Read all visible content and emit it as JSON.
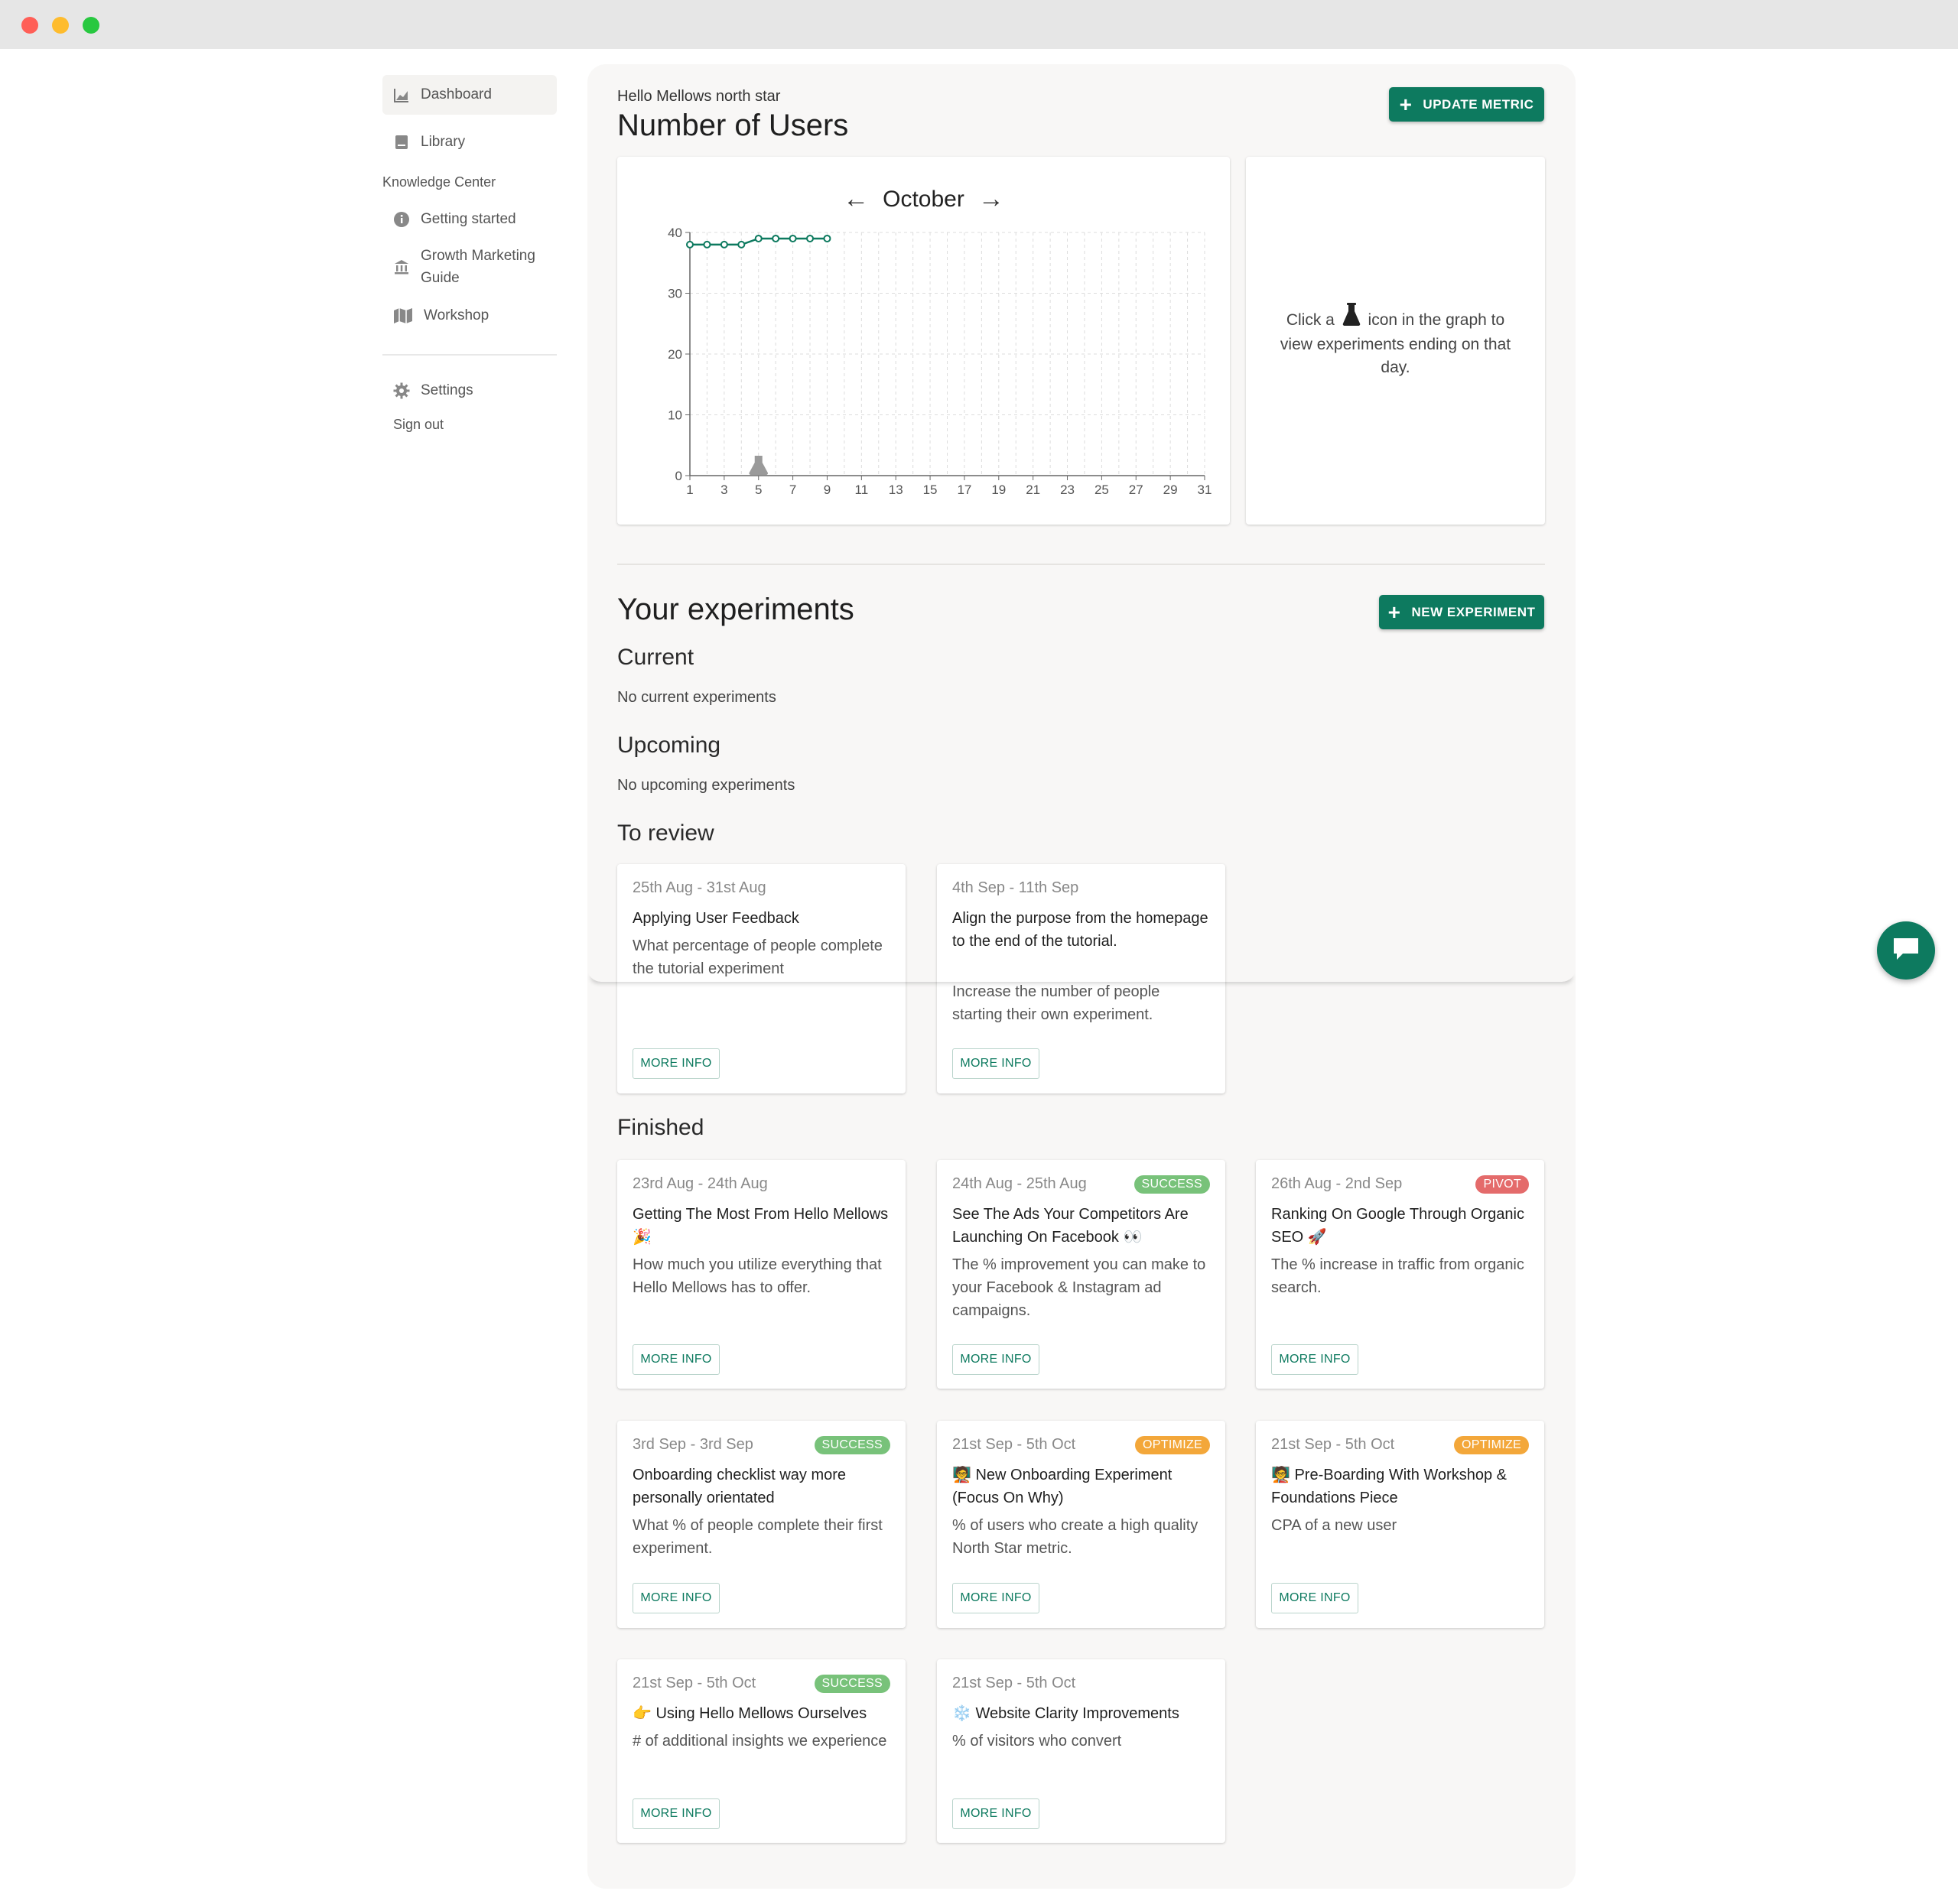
{
  "colors": {
    "accent": "#0d7a5f",
    "success": "#78c27a",
    "pivot": "#e46b6b",
    "optimize": "#f3a73a"
  },
  "sidebar": {
    "items": [
      {
        "label": "Dashboard",
        "icon": "chart-icon"
      },
      {
        "label": "Library",
        "icon": "book-icon"
      }
    ],
    "section_label": "Knowledge Center",
    "knowledge_items": [
      {
        "label": "Getting started",
        "icon": "info-icon"
      },
      {
        "label": "Growth Marketing Guide",
        "icon": "bank-icon"
      },
      {
        "label": "Workshop",
        "icon": "map-icon"
      }
    ],
    "settings_label": "Settings",
    "signout_label": "Sign out"
  },
  "header": {
    "subtitle": "Hello Mellows north star",
    "title": "Number of Users",
    "update_button": "UPDATE METRIC"
  },
  "chart": {
    "month": "October",
    "hint_before": "Click a",
    "hint_after": "icon in the graph to view experiments ending on that day."
  },
  "chart_data": {
    "type": "line",
    "x": [
      1,
      2,
      3,
      4,
      5,
      6,
      7,
      8,
      9
    ],
    "values": [
      38,
      38,
      38,
      38,
      39,
      39,
      39,
      39,
      39
    ],
    "xlim": [
      1,
      31
    ],
    "ylim": [
      0,
      40
    ],
    "xticks": [
      1,
      3,
      5,
      7,
      9,
      11,
      13,
      15,
      17,
      19,
      21,
      23,
      25,
      27,
      29,
      31
    ],
    "yticks": [
      0,
      10,
      20,
      30,
      40
    ],
    "grid": true,
    "experiment_marker_x": 5,
    "color": "#0d7a5f"
  },
  "experiments": {
    "title": "Your experiments",
    "new_button": "NEW EXPERIMENT",
    "current_label": "Current",
    "current_empty": "No current experiments",
    "upcoming_label": "Upcoming",
    "upcoming_empty": "No upcoming experiments",
    "review_label": "To review",
    "finished_label": "Finished",
    "more_info": "MORE INFO",
    "review": [
      {
        "dates": "25th Aug - 31st Aug",
        "title": "Applying User Feedback",
        "desc": "What percentage of people complete the tutorial experiment"
      },
      {
        "dates": "4th Sep - 11th Sep",
        "title": "Align the purpose from the homepage to the end of the tutorial.",
        "desc": "Increase the number of people starting their own experiment."
      }
    ],
    "finished": [
      {
        "dates": "23rd Aug - 24th Aug",
        "badge": "",
        "title": "Getting The Most From Hello Mellows 🎉",
        "desc": "How much you utilize everything that Hello Mellows has to offer."
      },
      {
        "dates": "24th Aug - 25th Aug",
        "badge": "SUCCESS",
        "title": "See The Ads Your Competitors Are Launching On Facebook 👀",
        "desc": "The % improvement you can make to your Facebook & Instagram ad campaigns."
      },
      {
        "dates": "26th Aug - 2nd Sep",
        "badge": "PIVOT",
        "title": "Ranking On Google Through Organic SEO 🚀",
        "desc": "The % increase in traffic from organic search."
      },
      {
        "dates": "3rd Sep - 3rd Sep",
        "badge": "SUCCESS",
        "title": "Onboarding checklist way more personally orientated",
        "desc": "What % of people complete their first experiment."
      },
      {
        "dates": "21st Sep - 5th Oct",
        "badge": "OPTIMIZE",
        "title": "🧑‍🏫 New Onboarding Experiment (Focus On Why)",
        "desc": "% of users who create a high quality North Star metric."
      },
      {
        "dates": "21st Sep - 5th Oct",
        "badge": "OPTIMIZE",
        "title": "🧑‍🏫 Pre-Boarding With Workshop & Foundations Piece",
        "desc": "CPA of a new user"
      },
      {
        "dates": "21st Sep - 5th Oct",
        "badge": "SUCCESS",
        "title": "👉 Using Hello Mellows Ourselves",
        "desc": "# of additional insights we experience"
      },
      {
        "dates": "21st Sep - 5th Oct",
        "badge": "",
        "title": "❄️ Website Clarity Improvements",
        "desc": "% of visitors who convert"
      }
    ]
  }
}
